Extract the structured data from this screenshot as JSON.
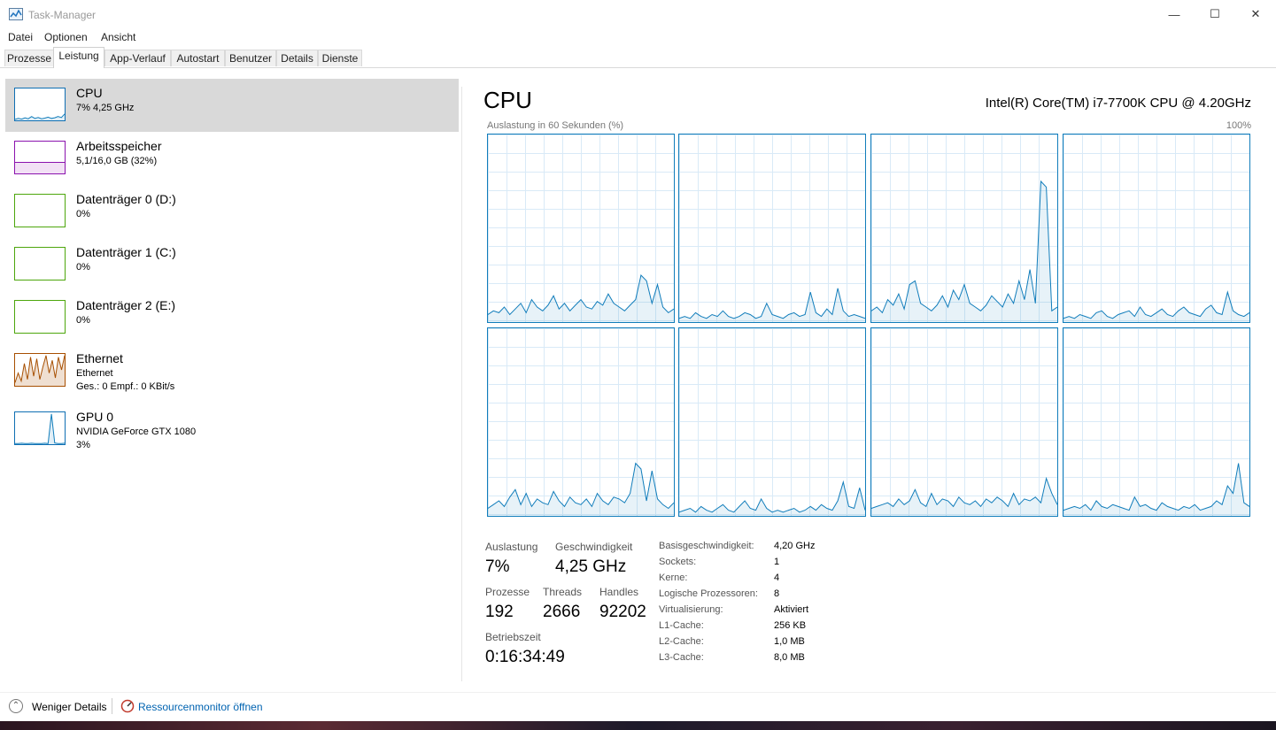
{
  "window": {
    "title": "Task-Manager",
    "minimize": "—",
    "maximize": "☐",
    "close": "✕"
  },
  "menu": [
    "Datei",
    "Optionen",
    "Ansicht"
  ],
  "tabs": [
    "Prozesse",
    "Leistung",
    "App-Verlauf",
    "Autostart",
    "Benutzer",
    "Details",
    "Dienste"
  ],
  "active_tab": "Leistung",
  "sidebar": [
    {
      "title": "CPU",
      "sub": "7% 4,25 GHz",
      "color": "#117dbb",
      "selected": true
    },
    {
      "title": "Arbeitsspeicher",
      "sub": "5,1/16,0 GB (32%)",
      "color": "#8b12ae"
    },
    {
      "title": "Datenträger 0 (D:)",
      "sub": "0%",
      "color": "#4da60c"
    },
    {
      "title": "Datenträger 1 (C:)",
      "sub": "0%",
      "color": "#4da60c"
    },
    {
      "title": "Datenträger 2 (E:)",
      "sub": "0%",
      "color": "#4da60c"
    },
    {
      "title": "Ethernet",
      "sub": "Ethernet",
      "sub2": "Ges.: 0 Empf.: 0 KBit/s",
      "color": "#a74f01"
    },
    {
      "title": "GPU 0",
      "sub": "NVIDIA GeForce GTX 1080",
      "sub2": "3%",
      "color": "#117dbb"
    }
  ],
  "main": {
    "title": "CPU",
    "model": "Intel(R) Core(TM) i7-7700K CPU @ 4.20GHz",
    "graph_label": "Auslastung in 60 Sekunden (%)",
    "graph_max": "100%",
    "graph_color": "#117dbb"
  },
  "stats": {
    "auslastung_label": "Auslastung",
    "auslastung": "7%",
    "geschwindigkeit_label": "Geschwindigkeit",
    "geschwindigkeit": "4,25 GHz",
    "prozesse_label": "Prozesse",
    "prozesse": "192",
    "threads_label": "Threads",
    "threads": "2666",
    "handles_label": "Handles",
    "handles": "92202",
    "betriebszeit_label": "Betriebszeit",
    "betriebszeit": "0:16:34:49"
  },
  "info": [
    {
      "label": "Basisgeschwindigkeit:",
      "value": "4,20 GHz"
    },
    {
      "label": "Sockets:",
      "value": "1"
    },
    {
      "label": "Kerne:",
      "value": "4"
    },
    {
      "label": "Logische Prozessoren:",
      "value": "8"
    },
    {
      "label": "Virtualisierung:",
      "value": "Aktiviert"
    },
    {
      "label": "L1-Cache:",
      "value": "256 KB"
    },
    {
      "label": "L2-Cache:",
      "value": "1,0 MB"
    },
    {
      "label": "L3-Cache:",
      "value": "8,0 MB"
    }
  ],
  "footer": {
    "fewer_details": "Weniger Details",
    "resource_monitor": "Ressourcenmonitor öffnen"
  },
  "core_series": [
    [
      4,
      6,
      5,
      8,
      4,
      7,
      10,
      5,
      12,
      8,
      6,
      9,
      14,
      7,
      10,
      6,
      9,
      12,
      8,
      7,
      11,
      9,
      15,
      10,
      8,
      6,
      9,
      12,
      25,
      22,
      10,
      20,
      8,
      5,
      7
    ],
    [
      2,
      3,
      2,
      5,
      3,
      2,
      4,
      3,
      6,
      3,
      2,
      3,
      5,
      4,
      2,
      3,
      10,
      4,
      3,
      2,
      4,
      5,
      3,
      4,
      16,
      5,
      3,
      7,
      4,
      18,
      6,
      3,
      4,
      3,
      2
    ],
    [
      6,
      8,
      5,
      12,
      9,
      15,
      7,
      20,
      22,
      10,
      8,
      6,
      9,
      14,
      8,
      17,
      12,
      20,
      10,
      8,
      6,
      9,
      14,
      11,
      8,
      15,
      10,
      22,
      12,
      28,
      10,
      75,
      72,
      6,
      8
    ],
    [
      2,
      3,
      2,
      4,
      3,
      2,
      5,
      6,
      3,
      2,
      4,
      5,
      6,
      3,
      8,
      4,
      3,
      5,
      7,
      4,
      3,
      6,
      8,
      5,
      4,
      3,
      7,
      9,
      5,
      4,
      16,
      6,
      4,
      3,
      5
    ],
    [
      4,
      6,
      8,
      5,
      10,
      14,
      6,
      12,
      5,
      9,
      7,
      6,
      13,
      8,
      5,
      10,
      7,
      6,
      9,
      5,
      12,
      8,
      6,
      10,
      9,
      7,
      12,
      28,
      25,
      8,
      24,
      9,
      6,
      4,
      7
    ],
    [
      2,
      3,
      4,
      2,
      5,
      3,
      2,
      4,
      6,
      3,
      2,
      5,
      8,
      4,
      3,
      9,
      4,
      2,
      3,
      2,
      3,
      4,
      2,
      3,
      5,
      3,
      6,
      4,
      3,
      8,
      18,
      5,
      4,
      15,
      3
    ],
    [
      4,
      5,
      6,
      7,
      5,
      9,
      6,
      8,
      14,
      7,
      5,
      12,
      6,
      9,
      8,
      5,
      10,
      7,
      6,
      8,
      5,
      9,
      7,
      10,
      8,
      5,
      12,
      6,
      9,
      8,
      10,
      7,
      20,
      12,
      6
    ],
    [
      3,
      4,
      5,
      4,
      6,
      3,
      8,
      5,
      4,
      6,
      5,
      4,
      3,
      10,
      5,
      6,
      4,
      3,
      7,
      5,
      4,
      3,
      5,
      4,
      6,
      3,
      4,
      5,
      8,
      6,
      16,
      12,
      28,
      7,
      5
    ]
  ],
  "sidebar_series": {
    "cpu": [
      3,
      6,
      4,
      8,
      5,
      12,
      6,
      9,
      5,
      7,
      10,
      6,
      8,
      12,
      9,
      20
    ],
    "ethernet": [
      10,
      40,
      15,
      70,
      20,
      90,
      30,
      85,
      20,
      60,
      95,
      40,
      80,
      25,
      90,
      50,
      95
    ],
    "gpu": [
      2,
      2,
      3,
      2,
      2,
      3,
      2,
      2,
      2,
      3,
      2,
      95,
      4,
      2,
      2,
      3
    ]
  }
}
